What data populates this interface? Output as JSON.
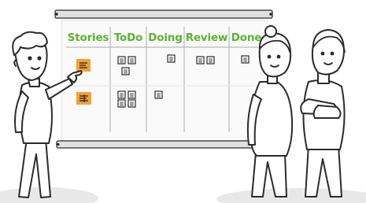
{
  "board": {
    "columns": [
      {
        "label": "Stories"
      },
      {
        "label": "ToDo"
      },
      {
        "label": "Doing"
      },
      {
        "label": "Review"
      },
      {
        "label": "Done"
      }
    ]
  },
  "colors": {
    "accent_green": "#5bb430",
    "story_card_orange": "#f4a233",
    "outline": "#2b2b2b",
    "board_frame": "#d8d8d8",
    "ground_shadow": "#e8e8e8"
  },
  "icons": [
    "story-card-icon",
    "task-card-icon"
  ]
}
